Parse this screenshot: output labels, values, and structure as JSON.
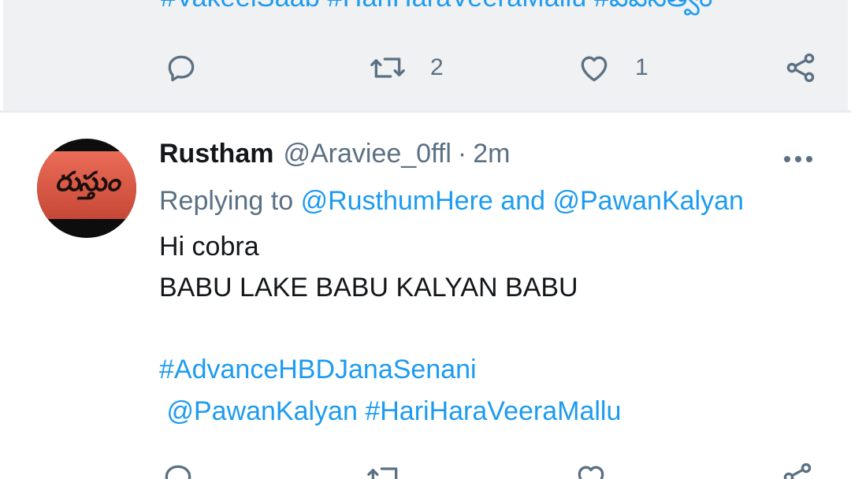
{
  "previous_tweet": {
    "hashtags": "#VakeelSaab #HariHaraVeeraMallu  #పవనత్వం",
    "retweet_count": "2",
    "like_count": "1"
  },
  "reply_tweet": {
    "display_name": "Rustham",
    "handle": "@Araviee_0ffl",
    "separator": "·",
    "time": "2m",
    "replying_prefix": "Replying to",
    "replying_user1": "@RusthumHere",
    "replying_and": "and",
    "replying_user2": "@PawanKalyan",
    "line1": "Hi cobra",
    "line2": "BABU LAKE BABU KALYAN BABU",
    "hashtag_line": "#AdvanceHBDJanaSenani",
    "mention_line": " @PawanKalyan #HariHaraVeeraMallu"
  },
  "icons": {
    "reply": "reply-icon",
    "retweet": "retweet-icon",
    "like": "heart-icon",
    "share": "share-icon",
    "more": "more-options-icon"
  },
  "colors": {
    "link": "#1d9bf0",
    "secondary_text": "#5b7083",
    "primary_text": "#14171a",
    "highlight_bg": "#eff1f2"
  }
}
